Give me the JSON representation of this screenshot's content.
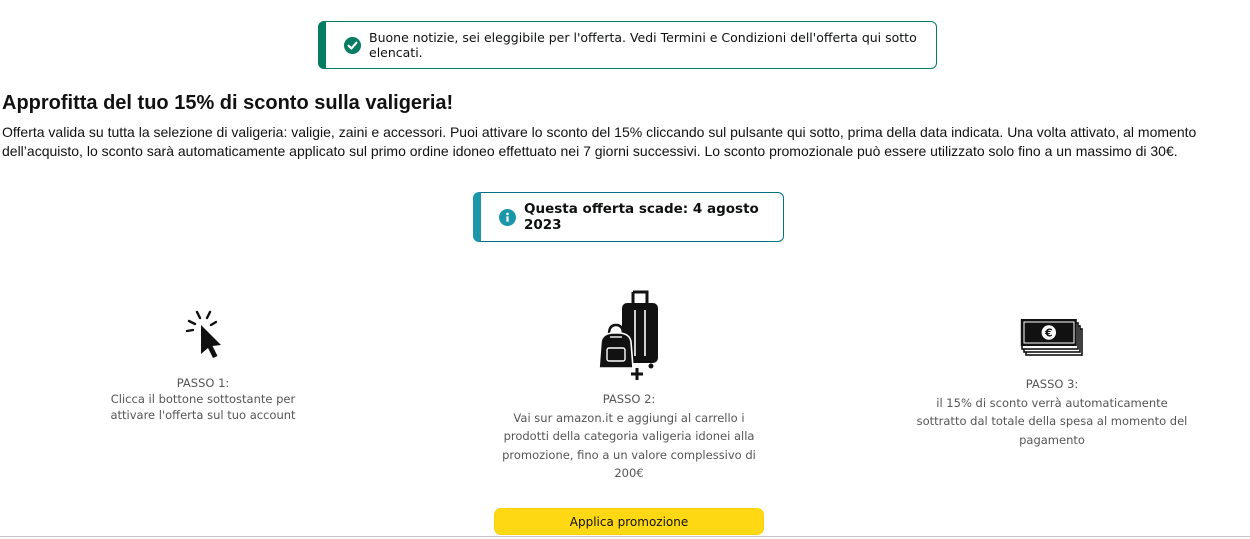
{
  "alert": {
    "message": "Buone notizie, sei eleggibile per l'offerta. Vedi Termini e Condizioni dell'offerta qui sotto elencati.",
    "icon": "check-circle-icon",
    "color": "#067d62"
  },
  "offer": {
    "title": "Approfitta del tuo 15% di sconto sulla valigeria!",
    "description": "Offerta valida su tutta la selezione di valigeria: valigie, zaini e accessori. Puoi attivare lo sconto del 15% cliccando sul pulsante qui sotto, prima della data indicata. Una volta attivato, al momento dell’acquisto, lo sconto sarà automaticamente applicato sul primo ordine idoneo effettuato nei 7 giorni successivi. Lo sconto promozionale può essere utilizzato solo fino a un massimo di 30€."
  },
  "expiry": {
    "text": "Questa offerta scade: 4 agosto 2023",
    "icon": "info-icon",
    "color": "#1a98aa"
  },
  "steps": [
    {
      "icon": "cursor-click-icon",
      "title": "PASSO 1:",
      "text": "Clicca il bottone sottostante per attivare l'offerta sul tuo account"
    },
    {
      "icon": "luggage-icon",
      "title": "PASSO 2:",
      "text": "Vai sur amazon.it e aggiungi al carrello i prodotti della categoria valigeria idonei alla promozione, fino a un valore complessivo di 200€"
    },
    {
      "icon": "banknotes-icon",
      "title": "PASSO 3:",
      "text": "il 15% di sconto verrà automaticamente sottratto dal totale della spesa al momento del pagamento"
    }
  ],
  "button": {
    "label": "Applica promozione",
    "color": "#ffd814"
  }
}
